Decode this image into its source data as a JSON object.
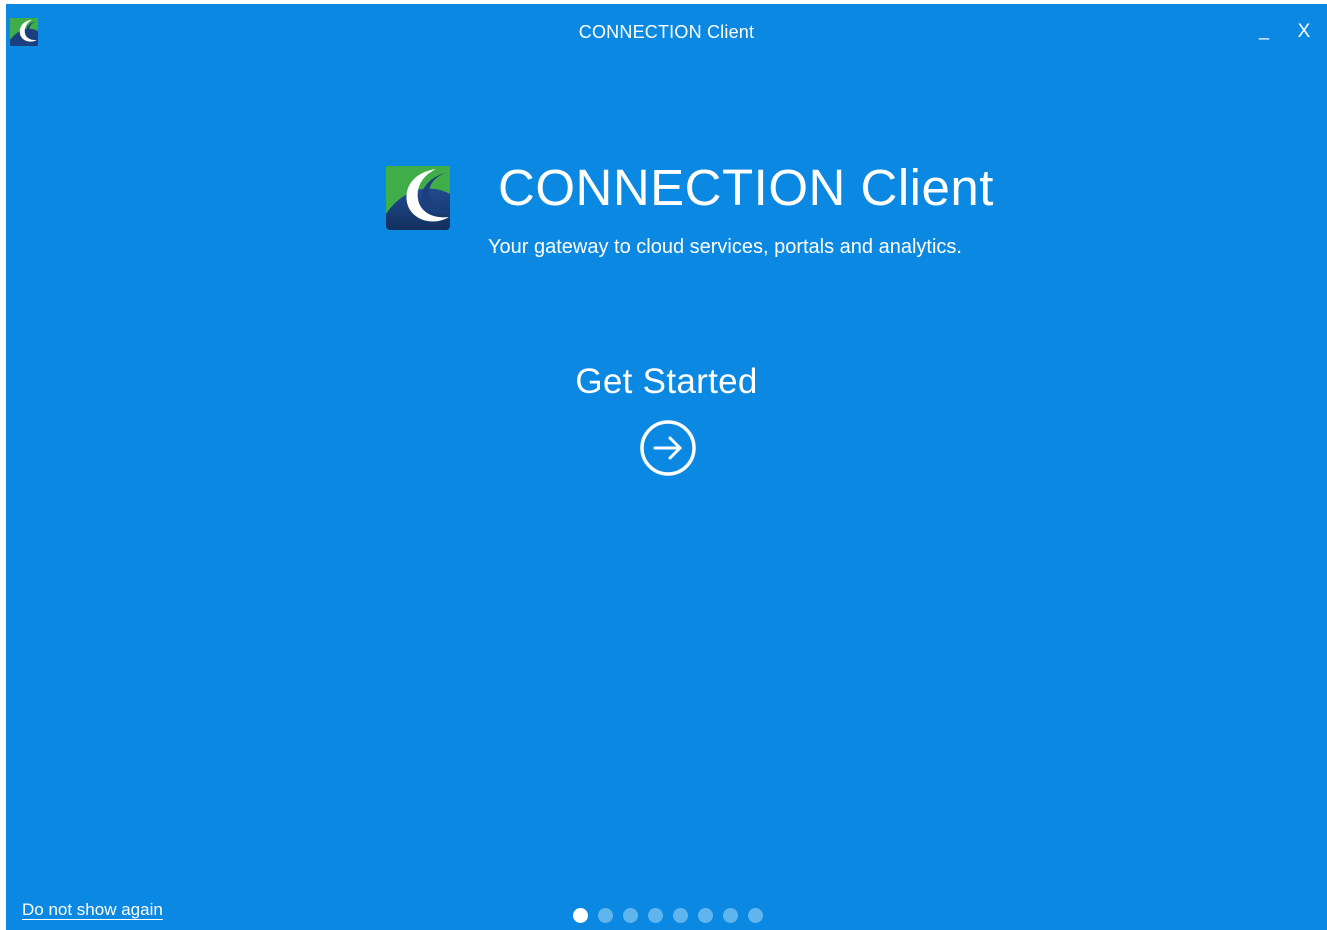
{
  "window": {
    "title": "CONNECTION Client",
    "minimize_label": "_",
    "close_label": "X",
    "background_color": "#0b89e2"
  },
  "titlebar": {
    "logo_icon": "connection-logo-icon"
  },
  "hero": {
    "logo_icon": "connection-logo-icon",
    "title": "CONNECTION Client",
    "subtitle": "Your gateway to cloud services, portals and analytics."
  },
  "get_started": {
    "label": "Get Started",
    "icon": "arrow-right-circle-icon"
  },
  "footer": {
    "do_not_show_label": "Do not show again"
  },
  "pager": {
    "total_pages": 8,
    "current_page": 1
  },
  "colors": {
    "logo_green": "#3fae49",
    "logo_navy": "#1b3f7f",
    "dot_inactive": "#61b5ee",
    "dot_active": "#ffffff"
  }
}
